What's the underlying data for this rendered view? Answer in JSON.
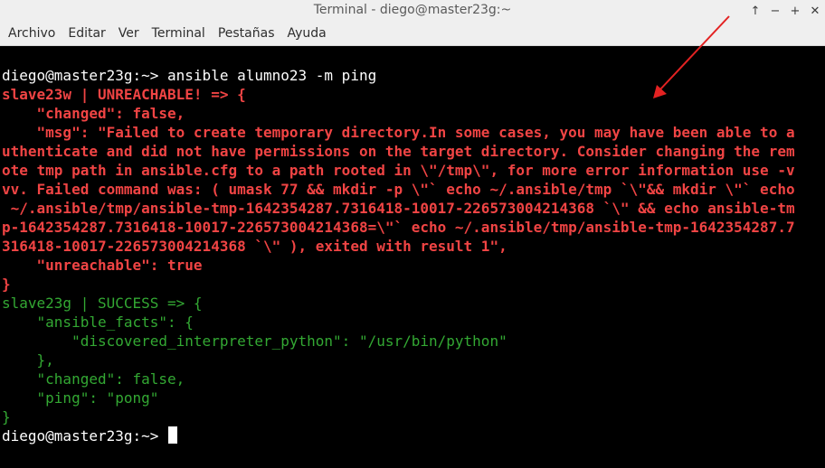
{
  "window": {
    "title": "Terminal - diego@master23g:~",
    "controls": [
      "↑",
      "−",
      "+",
      "✕"
    ]
  },
  "menu": {
    "items": [
      "Archivo",
      "Editar",
      "Ver",
      "Terminal",
      "Pestañas",
      "Ayuda"
    ]
  },
  "terminal": {
    "lines": [
      {
        "text": "diego@master23g:~> ansible alumno23 -m ping",
        "style": "plain"
      },
      {
        "text": "slave23w | UNREACHABLE! => {",
        "style": "red"
      },
      {
        "text": "    \"changed\": false,",
        "style": "red"
      },
      {
        "text": "    \"msg\": \"Failed to create temporary directory.In some cases, you may have been able to a",
        "style": "red"
      },
      {
        "text": "uthenticate and did not have permissions on the target directory. Consider changing the rem",
        "style": "red"
      },
      {
        "text": "ote tmp path in ansible.cfg to a path rooted in \\\"/tmp\\\", for more error information use -v",
        "style": "red"
      },
      {
        "text": "vv. Failed command was: ( umask 77 && mkdir -p \\\"` echo ~/.ansible/tmp `\\\"&& mkdir \\\"` echo",
        "style": "red"
      },
      {
        "text": " ~/.ansible/tmp/ansible-tmp-1642354287.7316418-10017-226573004214368 `\\\" && echo ansible-tm",
        "style": "red"
      },
      {
        "text": "p-1642354287.7316418-10017-226573004214368=\\\"` echo ~/.ansible/tmp/ansible-tmp-1642354287.7",
        "style": "red"
      },
      {
        "text": "316418-10017-226573004214368 `\\\" ), exited with result 1\",",
        "style": "red"
      },
      {
        "text": "    \"unreachable\": true",
        "style": "red"
      },
      {
        "text": "}",
        "style": "red"
      },
      {
        "text": "slave23g | SUCCESS => {",
        "style": "green"
      },
      {
        "text": "    \"ansible_facts\": {",
        "style": "green"
      },
      {
        "text": "        \"discovered_interpreter_python\": \"/usr/bin/python\"",
        "style": "green"
      },
      {
        "text": "    },",
        "style": "green"
      },
      {
        "text": "    \"changed\": false,",
        "style": "green"
      },
      {
        "text": "    \"ping\": \"pong\"",
        "style": "green"
      },
      {
        "text": "}",
        "style": "green"
      }
    ],
    "prompt": "diego@master23g:~> ",
    "colors": {
      "background": "#000000",
      "text": "#ffffff",
      "error": "#f04444",
      "success": "#33a833",
      "annotation_arrow": "#e32222"
    }
  }
}
